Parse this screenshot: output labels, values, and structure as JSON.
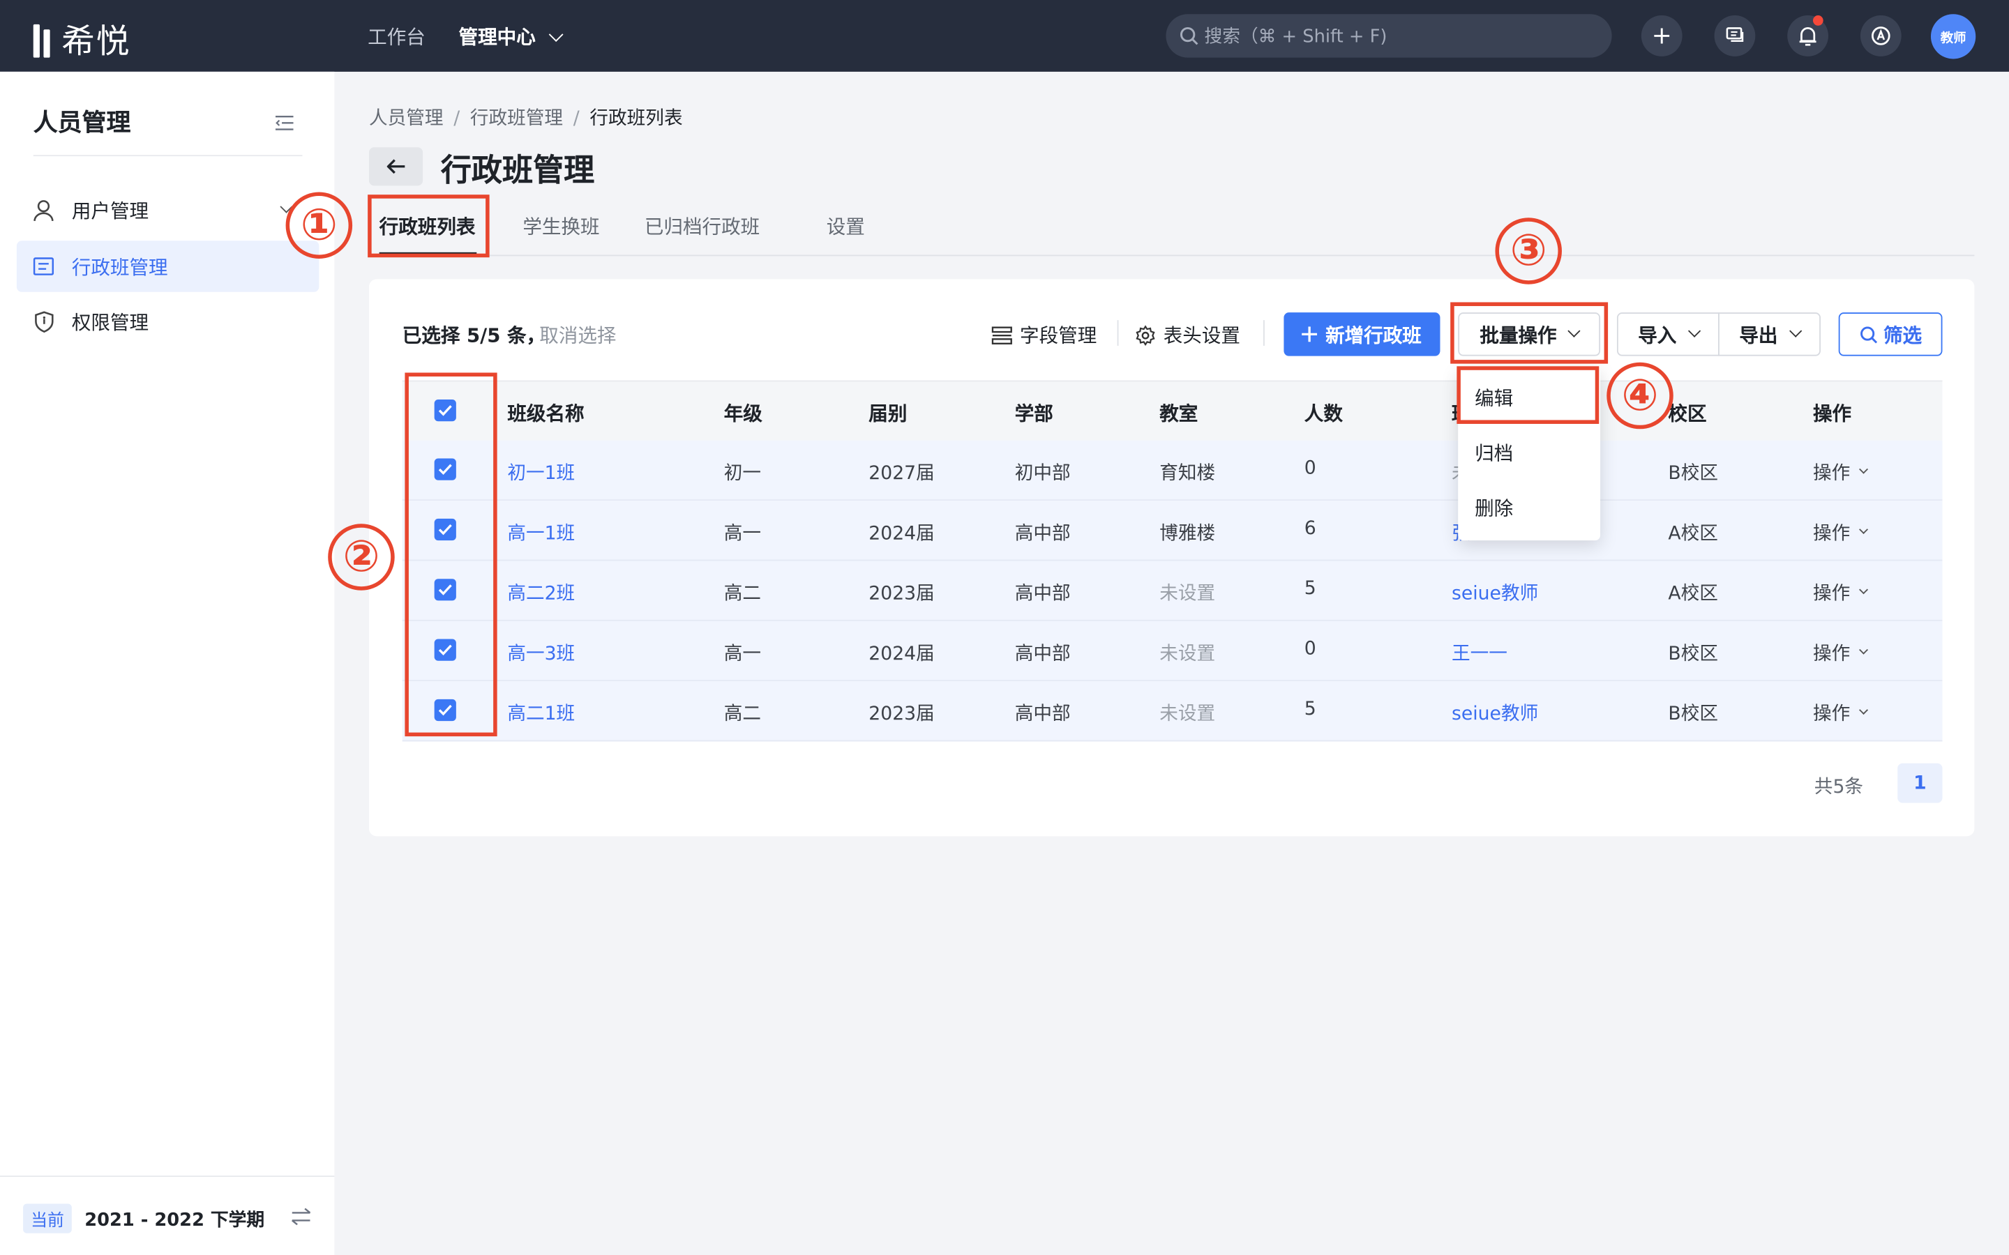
{
  "app": {
    "logo_text": "希悦",
    "nav": [
      "工作台",
      "管理中心"
    ],
    "search_placeholder": "搜索（⌘ + Shift + F)",
    "avatar_label": "教师",
    "icons": [
      "search-icon",
      "plus-icon",
      "message-icon",
      "bell-icon",
      "help-icon"
    ]
  },
  "sidebar": {
    "title": "人员管理",
    "items": [
      {
        "label": "用户管理",
        "icon": "user-icon",
        "active": false
      },
      {
        "label": "行政班管理",
        "icon": "class-icon",
        "active": true
      },
      {
        "label": "权限管理",
        "icon": "shield-icon",
        "active": false
      }
    ],
    "term_badge": "当前",
    "term": "2021 - 2022 下学期"
  },
  "breadcrumb": [
    "人员管理",
    "行政班管理",
    "行政班列表"
  ],
  "page_title": "行政班管理",
  "tabs": [
    "行政班列表",
    "学生换班",
    "已归档行政班",
    "设置"
  ],
  "toolbar": {
    "selected_text": "已选择 5/5 条，",
    "cancel_select": "取消选择",
    "field_manage": "字段管理",
    "header_settings": "表头设置",
    "add_class": "新增行政班",
    "batch_ops": "批量操作",
    "import": "导入",
    "export": "导出",
    "filter": "筛选"
  },
  "table": {
    "columns": [
      "班级名称",
      "年级",
      "届别",
      "学部",
      "教室",
      "人数",
      "班",
      "校区",
      "操作"
    ],
    "rows": [
      {
        "name": "初一1班",
        "grade": "初一",
        "cohort": "2027届",
        "division": "初中部",
        "room": "育知楼",
        "count": "0",
        "teacher": "未",
        "campus": "B校区",
        "op": "操作"
      },
      {
        "name": "高一1班",
        "grade": "高一",
        "cohort": "2024届",
        "division": "高中部",
        "room": "博雅楼",
        "count": "6",
        "teacher": "张",
        "campus": "A校区",
        "op": "操作"
      },
      {
        "name": "高二2班",
        "grade": "高二",
        "cohort": "2023届",
        "division": "高中部",
        "room": "未设置",
        "count": "5",
        "teacher": "seiue教师",
        "campus": "A校区",
        "op": "操作"
      },
      {
        "name": "高一3班",
        "grade": "高一",
        "cohort": "2024届",
        "division": "高中部",
        "room": "未设置",
        "count": "0",
        "teacher": "王一一",
        "campus": "B校区",
        "op": "操作"
      },
      {
        "name": "高二1班",
        "grade": "高二",
        "cohort": "2023届",
        "division": "高中部",
        "room": "未设置",
        "count": "5",
        "teacher": "seiue教师",
        "campus": "B校区",
        "op": "操作"
      }
    ]
  },
  "dropdown": [
    "编辑",
    "归档",
    "删除"
  ],
  "pagination": {
    "total": "共5条",
    "page": "1"
  },
  "annotations": [
    "①",
    "②",
    "③",
    "④"
  ],
  "colors": {
    "accent": "#3b78f5",
    "annotation": "#e8462e",
    "topbar": "#262d3d"
  }
}
